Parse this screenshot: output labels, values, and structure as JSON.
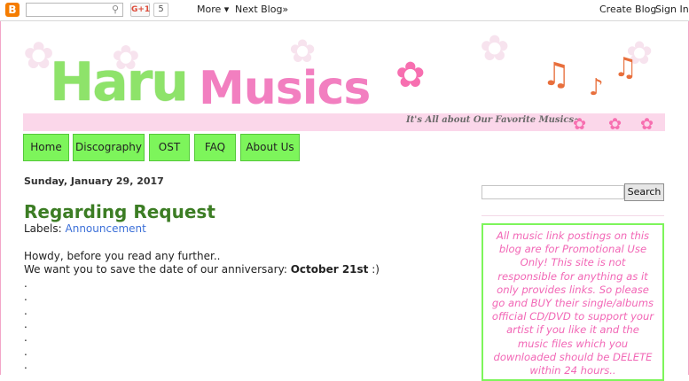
{
  "navbar": {
    "logo_glyph": "B",
    "search_icon": "magnifier-icon",
    "gplus_label": "G+1",
    "gplus_count": "5",
    "more_label": "More ▾",
    "next_blog_label": "Next Blog»",
    "create_blog_label": "Create Blog",
    "sign_in_label": "Sign In"
  },
  "header": {
    "title_part1": "Haru",
    "title_part2": "Musics",
    "tagline": "It's All about Our Favorite Musics~"
  },
  "tabs": [
    {
      "label": "Home"
    },
    {
      "label": "Discography"
    },
    {
      "label": "OST"
    },
    {
      "label": "FAQ"
    },
    {
      "label": "About Us"
    }
  ],
  "post": {
    "date": "Sunday, January 29, 2017",
    "title": "Regarding Request",
    "labels_prefix": "Labels:",
    "label_link": "Announcement",
    "line1": "Howdy, before you read any further..",
    "line2_prefix": "We want you to save the date of our anniversary:",
    "line2_bold": "October 21st",
    "line2_suffix": " :)",
    "dots": [
      ".",
      ".",
      ".",
      ".",
      ".",
      ".",
      "."
    ]
  },
  "sidebar": {
    "search_button_label": "Search",
    "notice": "All music link postings on this blog are for Promotional Use Only! This site is not responsible for anything as it only provides links. So please go and BUY their single/albums official CD/DVD to support your artist if you like it and the music files which you downloaded should be DELETE within 24 hours.."
  },
  "colors": {
    "accent_green": "#7df55b",
    "accent_pink": "#f27fc0",
    "title_green": "#3c7d24",
    "link_blue": "#3b6fd8"
  }
}
